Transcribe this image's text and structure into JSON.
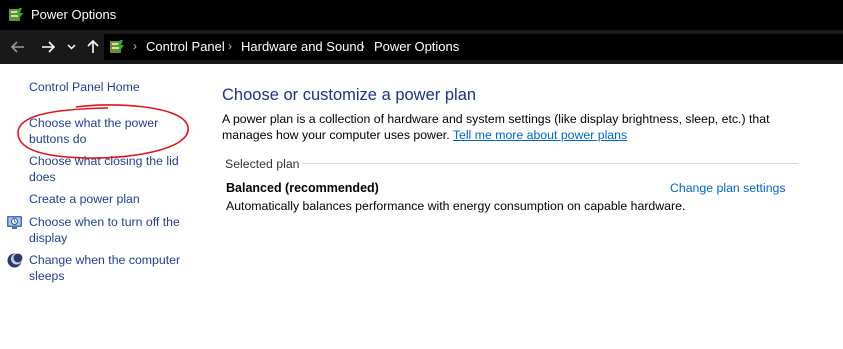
{
  "window": {
    "title": "Power Options",
    "icon": "power-options-icon"
  },
  "address_bar": {
    "back_icon": "arrow-left-icon",
    "forward_icon": "arrow-right-icon",
    "recent_icon": "chevron-down-icon",
    "up_icon": "arrow-up-icon",
    "location_icon": "control-panel-icon",
    "breadcrumbs": [
      "Control Panel",
      "Hardware and Sound",
      "Power Options"
    ]
  },
  "sidebar": {
    "items": [
      {
        "label": "Control Panel Home",
        "icon": null
      },
      {
        "label": "Choose what the power\nbuttons do",
        "icon": null
      },
      {
        "label": "Choose what closing the lid\ndoes",
        "icon": null
      },
      {
        "label": "Create a power plan",
        "icon": null
      },
      {
        "label": "Choose when to turn off the\ndisplay",
        "icon": "display-icon"
      },
      {
        "label": "Change when the computer\nsleeps",
        "icon": "sleep-moon-icon"
      }
    ]
  },
  "main": {
    "heading": "Choose or customize a power plan",
    "description": "A power plan is a collection of hardware and system settings (like display brightness, sleep, etc.) that manages how your computer uses power.",
    "learn_more_link": "Tell me more about power plans",
    "selected_plan_label": "Selected plan",
    "plan": {
      "name": "Balanced (recommended)",
      "change_link": "Change plan settings",
      "description": "Automatically balances performance with energy consumption on capable hardware."
    }
  },
  "colors": {
    "link_sidebar": "#1f3f8f",
    "link": "#0066cc",
    "heading": "#1e3287",
    "annotation": "#e0141c",
    "titlebar_bg": "#000000"
  }
}
